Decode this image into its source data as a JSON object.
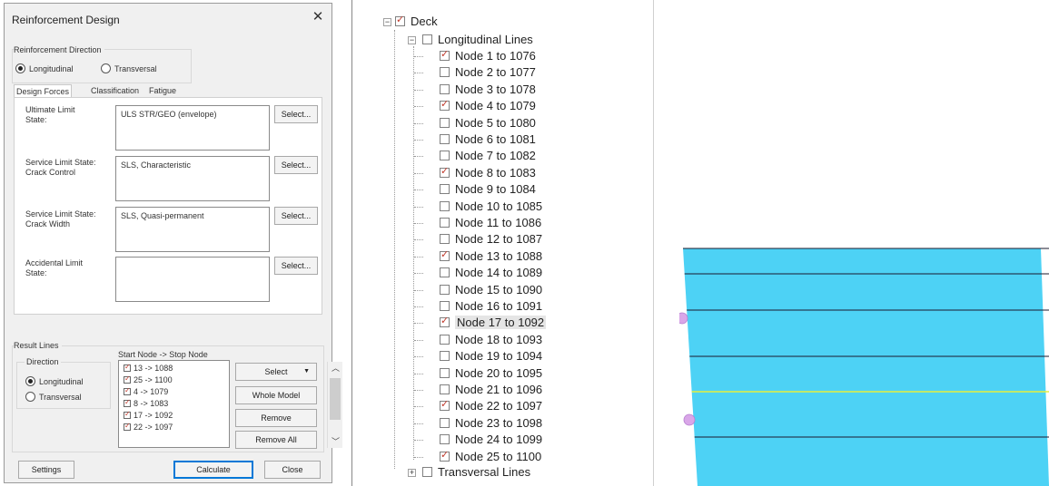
{
  "dialog": {
    "title": "Reinforcement Design",
    "reinforcement_direction": {
      "label": "Reinforcement Direction",
      "options": [
        "Longitudinal",
        "Transversal"
      ],
      "selected": "Longitudinal"
    },
    "tabs": [
      {
        "label": "Design Forces",
        "active": true
      },
      {
        "label": "Classification",
        "active": false
      },
      {
        "label": "Fatigue",
        "active": false
      }
    ],
    "fields": [
      {
        "label_line1": "Ultimate Limit",
        "label_line2": "State:",
        "value": "ULS STR/GEO (envelope)",
        "button": "Select..."
      },
      {
        "label_line1": "Service Limit State:",
        "label_line2": "Crack Control",
        "value": "SLS, Characteristic",
        "button": "Select..."
      },
      {
        "label_line1": "Service Limit State:",
        "label_line2": "Crack Width",
        "value": "SLS, Quasi-permanent",
        "button": "Select..."
      },
      {
        "label_line1": "Accidental Limit",
        "label_line2": "State:",
        "value": "",
        "button": "Select..."
      }
    ],
    "result_lines": {
      "label": "Result Lines",
      "direction_label": "Direction",
      "direction_options": [
        "Longitudinal",
        "Transversal"
      ],
      "direction_selected": "Longitudinal",
      "list_header": "Start Node -> Stop Node",
      "items": [
        {
          "text": "13 -> 1088",
          "checked": true
        },
        {
          "text": "25 -> 1100",
          "checked": true
        },
        {
          "text": "4 -> 1079",
          "checked": true
        },
        {
          "text": "8 -> 1083",
          "checked": true
        },
        {
          "text": "17 -> 1092",
          "checked": true
        },
        {
          "text": "22 -> 1097",
          "checked": true
        }
      ],
      "buttons": {
        "select": "Select",
        "whole_model": "Whole Model",
        "remove": "Remove",
        "remove_all": "Remove All"
      }
    },
    "footer": {
      "settings": "Settings",
      "calculate": "Calculate",
      "close": "Close"
    }
  },
  "tree": {
    "root": {
      "label": "Deck",
      "checked": true
    },
    "longitudinal": {
      "label": "Longitudinal Lines",
      "checked": false
    },
    "nodes": [
      {
        "label": "Node 1 to 1076",
        "checked": true
      },
      {
        "label": "Node 2 to 1077",
        "checked": false
      },
      {
        "label": "Node 3 to 1078",
        "checked": false
      },
      {
        "label": "Node 4 to 1079",
        "checked": true
      },
      {
        "label": "Node 5 to 1080",
        "checked": false
      },
      {
        "label": "Node 6 to 1081",
        "checked": false
      },
      {
        "label": "Node 7 to 1082",
        "checked": false
      },
      {
        "label": "Node 8 to 1083",
        "checked": true
      },
      {
        "label": "Node 9 to 1084",
        "checked": false
      },
      {
        "label": "Node 10 to 1085",
        "checked": false
      },
      {
        "label": "Node 11 to 1086",
        "checked": false
      },
      {
        "label": "Node 12 to 1087",
        "checked": false
      },
      {
        "label": "Node 13 to 1088",
        "checked": true
      },
      {
        "label": "Node 14 to 1089",
        "checked": false
      },
      {
        "label": "Node 15 to 1090",
        "checked": false
      },
      {
        "label": "Node 16 to 1091",
        "checked": false
      },
      {
        "label": "Node 17 to 1092",
        "checked": true,
        "selected": true
      },
      {
        "label": "Node 18 to 1093",
        "checked": false
      },
      {
        "label": "Node 19 to 1094",
        "checked": false
      },
      {
        "label": "Node 20 to 1095",
        "checked": false
      },
      {
        "label": "Node 21 to 1096",
        "checked": false
      },
      {
        "label": "Node 22 to 1097",
        "checked": true
      },
      {
        "label": "Node 23 to 1098",
        "checked": false
      },
      {
        "label": "Node 24 to 1099",
        "checked": false
      },
      {
        "label": "Node 25 to 1100",
        "checked": true
      }
    ],
    "transversal": {
      "label": "Transversal Lines",
      "checked": false
    }
  },
  "colors": {
    "deck_fill": "#4dd2f5",
    "deck_line": "#1a1a2e",
    "highlight_line": "#e6f03c",
    "node_marker": "#d9a6e8",
    "check_mark": "#c0392b"
  }
}
